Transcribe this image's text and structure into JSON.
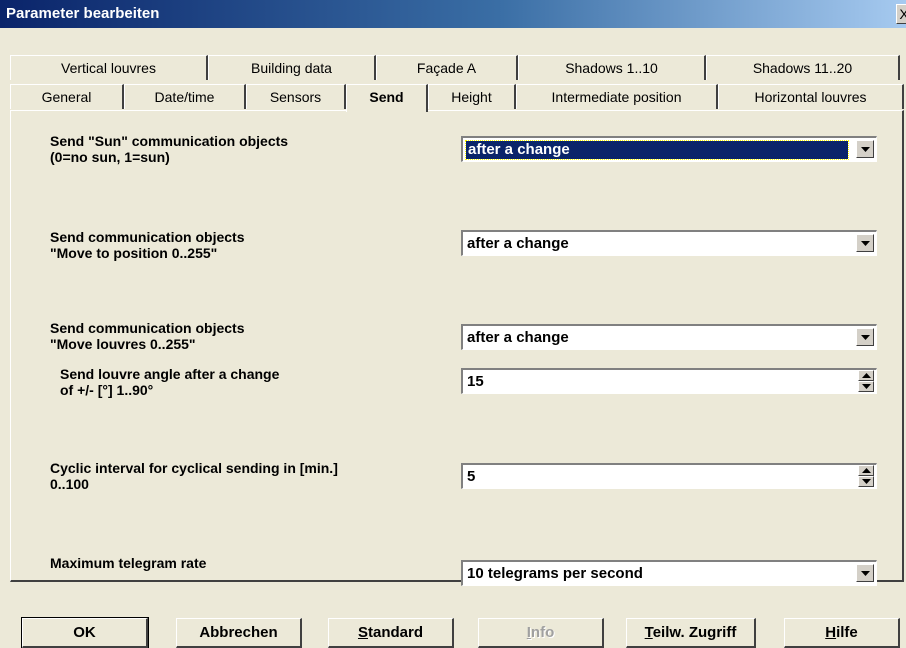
{
  "window": {
    "title": "Parameter bearbeiten",
    "close_glyph": "X"
  },
  "tabs_back": [
    "Vertical louvres",
    "Building data",
    "Façade A",
    "Shadows 1..10",
    "Shadows 11..20"
  ],
  "tabs_front": [
    "General",
    "Date/time",
    "Sensors",
    "Send",
    "Height",
    "Intermediate position",
    "Horizontal louvres"
  ],
  "active_tab": "Send",
  "params": {
    "sun": {
      "label1": "Send \"Sun\" communication objects",
      "label2": "(0=no sun, 1=sun)",
      "value": "after a change"
    },
    "pos": {
      "label1": "Send communication objects",
      "label2": "\"Move to position 0..255\"",
      "value": "after a change"
    },
    "louv": {
      "label1": "Send communication objects",
      "label2": "\"Move louvres 0..255\"",
      "value": "after a change"
    },
    "angle": {
      "label1": "Send louvre angle after a change",
      "label2": "of +/- [°]   1..90°",
      "value": "15"
    },
    "cyclic": {
      "label1": "Cyclic interval for cyclical sending in [min.]",
      "label2": "0..100",
      "value": "5"
    },
    "rate": {
      "label1": "Maximum telegram rate",
      "value": "10 telegrams per second"
    }
  },
  "buttons": {
    "ok": "OK",
    "cancel": "Abbrechen",
    "standard_u": "S",
    "standard_rest": "tandard",
    "info_u": "I",
    "info_rest": "nfo",
    "teilw_u": "T",
    "teilw_rest": "eilw. Zugriff",
    "hilfe_u": "H",
    "hilfe_rest": "ilfe"
  },
  "colors": {
    "face": "#ece9d8",
    "title_start": "#0a246a",
    "highlight": "#0a246a"
  },
  "icons": {
    "dropdown": "chevron-down-icon",
    "spin": "spin-arrows-icon",
    "close": "close-icon"
  }
}
